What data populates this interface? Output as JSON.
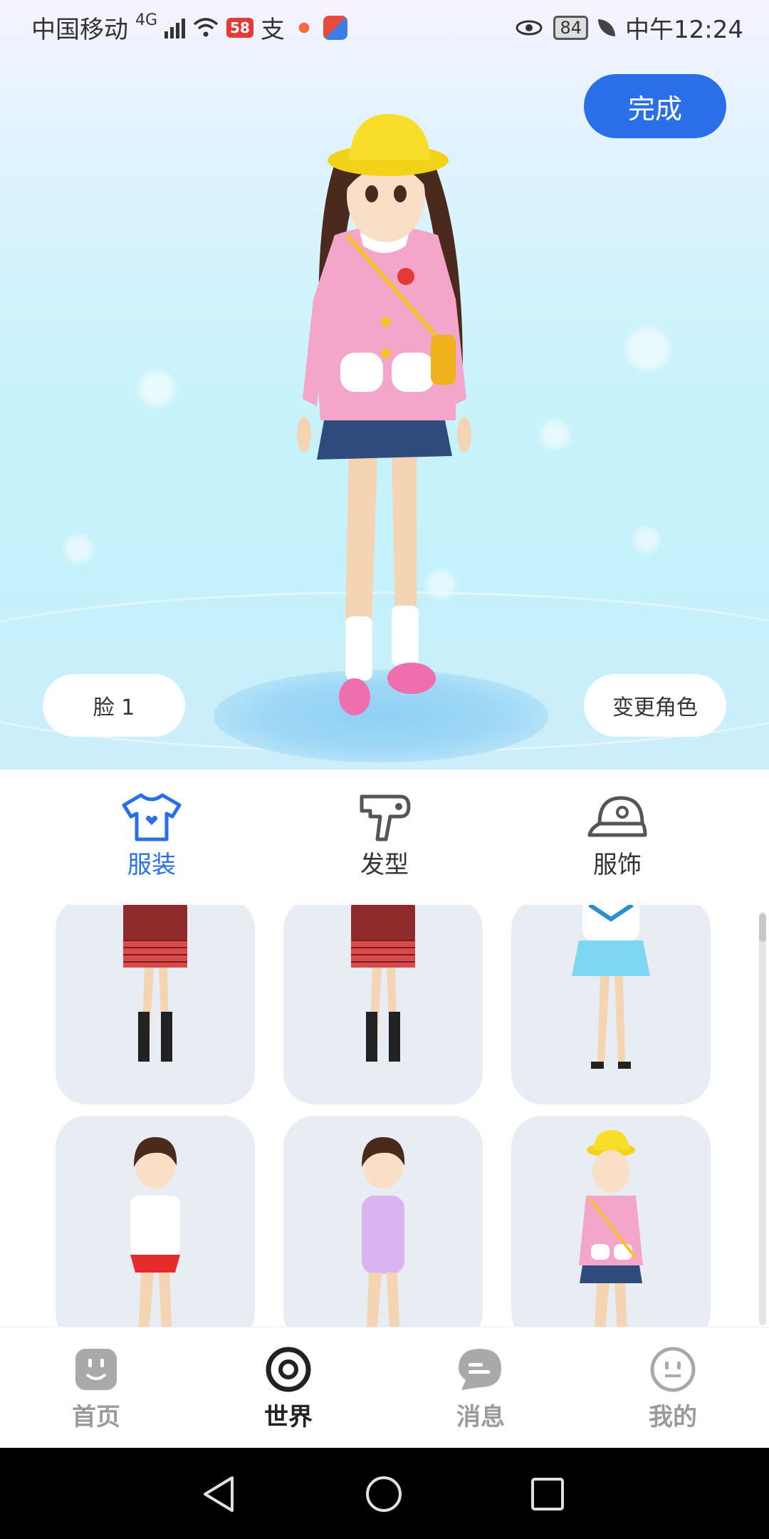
{
  "status_bar": {
    "carrier": "中国移动",
    "network": "4G",
    "badge": "58",
    "battery": "84",
    "time": "中午12:24"
  },
  "editor": {
    "done_label": "完成",
    "face_label": "脸 1",
    "change_character_label": "变更角色"
  },
  "category_tabs": [
    {
      "label": "服装",
      "icon": "tshirt-icon",
      "active": true
    },
    {
      "label": "发型",
      "icon": "hair-dryer-icon",
      "active": false
    },
    {
      "label": "服饰",
      "icon": "cap-icon",
      "active": false
    }
  ],
  "outfits": [
    {
      "name": "red-blazer-uniform-1"
    },
    {
      "name": "red-blazer-uniform-2"
    },
    {
      "name": "sailor-uniform-blue"
    },
    {
      "name": "gym-uniform"
    },
    {
      "name": "purple-swimsuit"
    },
    {
      "name": "kindergarten-pink-uniform"
    }
  ],
  "bottom_nav": [
    {
      "label": "首页",
      "icon": "home-face-icon",
      "active": false
    },
    {
      "label": "世界",
      "icon": "world-target-icon",
      "active": true
    },
    {
      "label": "消息",
      "icon": "message-bubble-icon",
      "active": false
    },
    {
      "label": "我的",
      "icon": "profile-face-icon",
      "active": false
    }
  ],
  "colors": {
    "accent": "#2b6fe8",
    "inactive": "#9a9a9a",
    "card_bg": "#e8ecf3"
  }
}
